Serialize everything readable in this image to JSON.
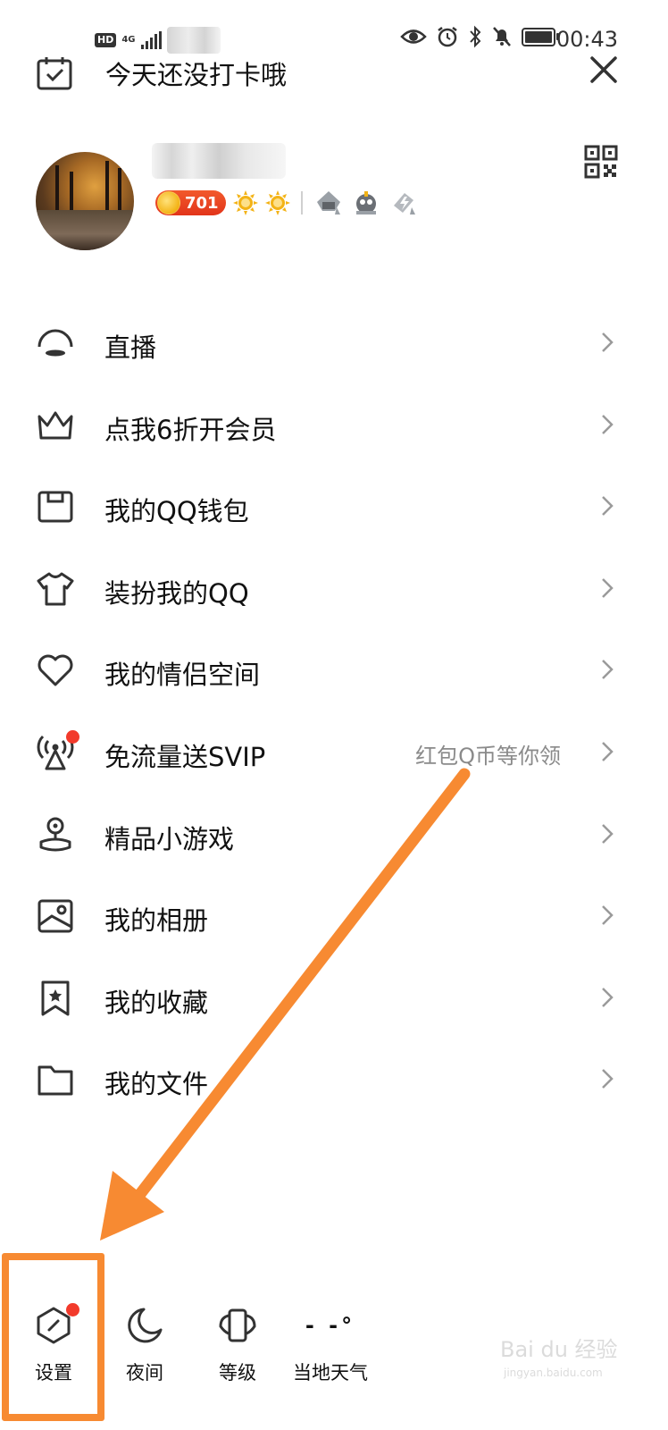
{
  "status_bar": {
    "hd": "HD",
    "network": "4G",
    "time": "00:43",
    "icons": [
      "eye-icon",
      "alarm-icon",
      "bluetooth-icon",
      "mute-icon",
      "battery-icon"
    ]
  },
  "header": {
    "checkin_text": "今天还没打卡哦",
    "close_icon": "close-icon"
  },
  "profile": {
    "level_number": "701",
    "qr_icon": "qr-code-icon"
  },
  "menu": {
    "items": [
      {
        "label": "直播",
        "icon": "live-icon"
      },
      {
        "label": "点我6折开会员",
        "icon": "crown-icon"
      },
      {
        "label": "我的QQ钱包",
        "icon": "wallet-icon"
      },
      {
        "label": "装扮我的QQ",
        "icon": "shirt-icon"
      },
      {
        "label": "我的情侣空间",
        "icon": "heart-icon"
      },
      {
        "label": "免流量送SVIP",
        "icon": "signal-tower-icon",
        "hint": "红包Q币等你领"
      },
      {
        "label": "精品小游戏",
        "icon": "game-icon"
      },
      {
        "label": "我的相册",
        "icon": "album-icon"
      },
      {
        "label": "我的收藏",
        "icon": "bookmark-icon"
      },
      {
        "label": "我的文件",
        "icon": "folder-icon"
      }
    ]
  },
  "bottom_bar": {
    "items": [
      {
        "label": "设置",
        "icon": "settings-icon"
      },
      {
        "label": "夜间",
        "icon": "moon-icon"
      },
      {
        "label": "等级",
        "icon": "level-icon"
      },
      {
        "label": "当地天气",
        "icon": "weather-icon",
        "weather_value": "- -°"
      }
    ]
  },
  "colors": {
    "accent_orange": "#f78a32",
    "red_dot": "#f23a2b",
    "hint_gray": "#8a8a8a"
  },
  "watermark": {
    "brand": "Bai du 经验",
    "url": "jingyan.baidu.com"
  }
}
